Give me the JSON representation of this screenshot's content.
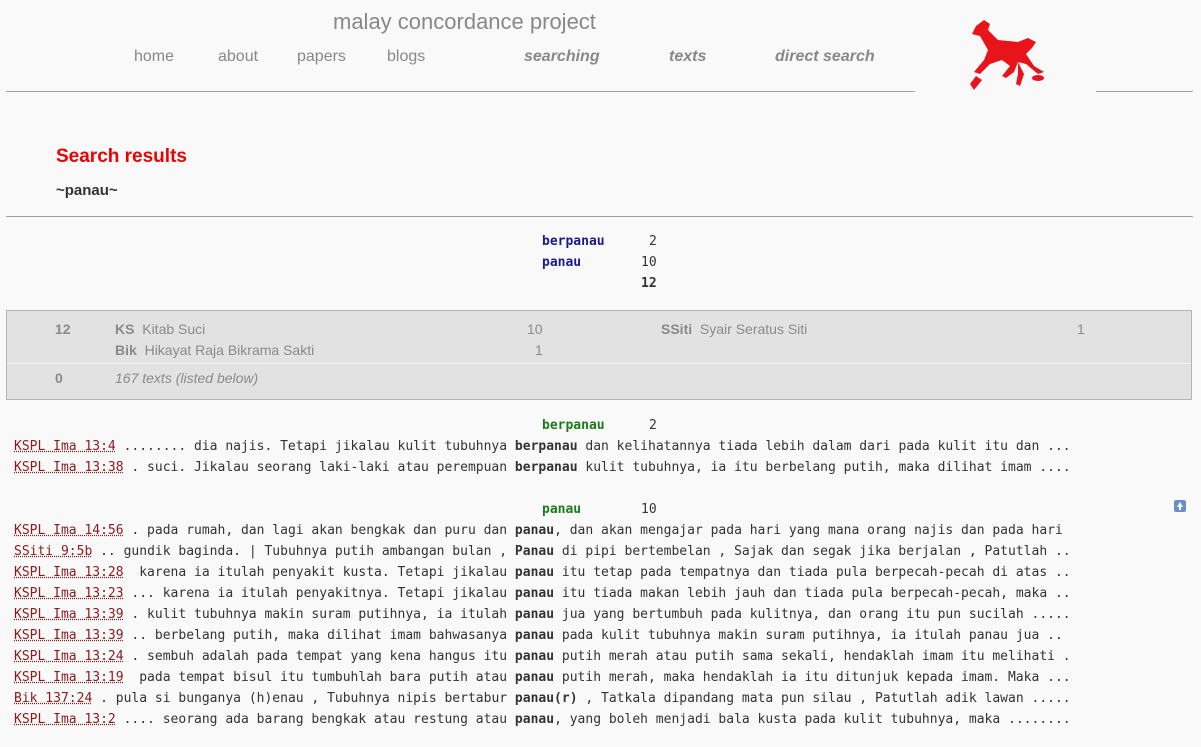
{
  "site": {
    "title": "malay concordance project"
  },
  "nav": [
    "home",
    "about",
    "papers",
    "blogs",
    "searching",
    "texts",
    "direct search"
  ],
  "results": {
    "title": "Search results",
    "term": "~panau~"
  },
  "summary": {
    "rows": [
      {
        "word": "berpanau",
        "count": "2"
      },
      {
        "word": "panau",
        "count": "10"
      }
    ],
    "total": "12"
  },
  "sources": {
    "found_count": "12",
    "texts": [
      {
        "code": "KS",
        "name": "Kitab Suci",
        "count": "10"
      },
      {
        "code": "Bik",
        "name": "Hikayat Raja Bikrama Sakti",
        "count": "1"
      },
      {
        "code": "SSiti",
        "name": "Syair Seratus Siti",
        "count": "1"
      }
    ],
    "none_count": "0",
    "none_text": "167 texts (listed below)"
  },
  "groups": [
    {
      "word": "berpanau",
      "count": "2",
      "lines": [
        {
          "ref": "KSPL Ima 13:4",
          "pre": " ........ dia najis. Tetapi jikalau kulit tubuhnya ",
          "kw": "berpanau",
          "post": " dan kelihatannya tiada lebih dalam dari pada kulit itu dan ..."
        },
        {
          "ref": "KSPL Ima 13:38",
          "pre": " . suci. Jikalau seorang laki-laki atau perempuan ",
          "kw": "berpanau",
          "post": " kulit tubuhnya, ia itu berbelang putih, maka dilihat imam ...."
        }
      ]
    },
    {
      "word": "panau",
      "count": "10",
      "lines": [
        {
          "ref": "KSPL Ima 14:56",
          "pre": " . pada rumah, dan lagi akan bengkak dan puru dan ",
          "kw": "panau",
          "post": ", dan akan mengajar pada hari yang mana orang najis dan pada hari"
        },
        {
          "ref": "SSiti 9:5b",
          "pre": " .. gundik baginda. | Tubuhnya putih ambangan bulan , ",
          "kw": "Panau",
          "post": " di pipi bertembelan , Sajak dan segak jika berjalan , Patutlah .."
        },
        {
          "ref": "KSPL Ima 13:28",
          "pre": "  karena ia itulah penyakit kusta. Tetapi jikalau ",
          "kw": "panau",
          "post": " itu tetap pada tempatnya dan tiada pula berpecah-pecah di atas .."
        },
        {
          "ref": "KSPL Ima 13:23",
          "pre": " ... karena ia itulah penyakitnya. Tetapi jikalau ",
          "kw": "panau",
          "post": " itu tiada makan lebih jauh dan tiada pula berpecah-pecah, maka .."
        },
        {
          "ref": "KSPL Ima 13:39",
          "pre": " . kulit tubuhnya makin suram putihnya, ia itulah ",
          "kw": "panau",
          "post": " jua yang bertumbuh pada kulitnya, dan orang itu pun sucilah ....."
        },
        {
          "ref": "KSPL Ima 13:39",
          "pre": " .. berbelang putih, maka dilihat imam bahwasanya ",
          "kw": "panau",
          "post": " pada kulit tubuhnya makin suram putihnya, ia itulah panau jua .."
        },
        {
          "ref": "KSPL Ima 13:24",
          "pre": " . sembuh adalah pada tempat yang kena hangus itu ",
          "kw": "panau",
          "post": " putih merah atau putih sama sekali, hendaklah imam itu melihati ."
        },
        {
          "ref": "KSPL Ima 13:19",
          "pre": "  pada tempat bisul itu tumbuhlah bara putih atau ",
          "kw": "panau",
          "post": " putih merah, maka hendaklah ia itu ditunjuk kepada imam. Maka ..."
        },
        {
          "ref": "Bik 137:24",
          "pre": " . pula si bunganya (h)enau , Tubuhnya nipis bertabur ",
          "kw": "panau(r)",
          "post": " , Tatkala dipandang mata pun silau , Patutlah adik lawan ....."
        },
        {
          "ref": "KSPL Ima 13:2",
          "pre": " .... seorang ada barang bengkak atau restung atau ",
          "kw": "panau",
          "post": ", yang boleh menjadi bala kusta pada kulit tubuhnya, maka ........"
        }
      ]
    }
  ],
  "icons": {
    "logo": "red-horse-logo",
    "back_to_top": "arrow-up-icon"
  },
  "colors": {
    "accent": "#e00000",
    "summary_word": "#1a1a8c",
    "group_word": "#1b7a1b",
    "reference": "#8b1a1a"
  }
}
